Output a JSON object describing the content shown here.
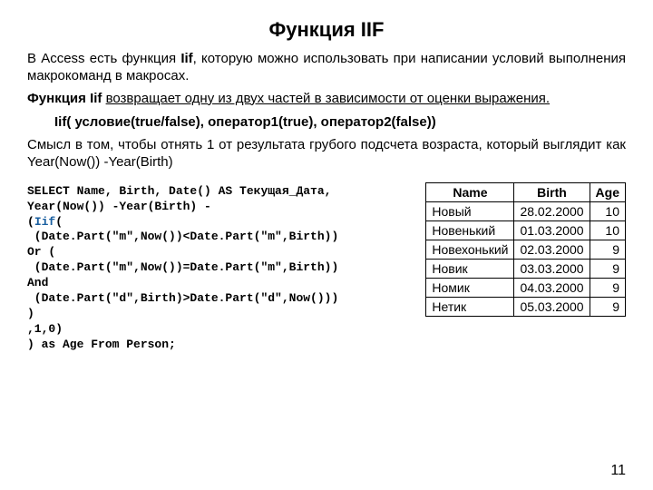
{
  "title": "Функция IIF",
  "para1_a": "В Access есть функция ",
  "para1_iif": "Iif",
  "para1_b": ", которую можно использовать при написании условий выполнения макрокоманд в макросах.",
  "para2_a": "Функция Iif ",
  "para2_b": "возвращает одну из двух частей в зависимости от оценки выражения.",
  "syntax": "Iif( условие(true/false), оператор1(true), оператор2(false))",
  "para3": "Смысл в том, чтобы отнять 1 от результата грубого подсчета возраста, который выглядит как Year(Now()) -Year(Birth)",
  "code": {
    "l1": "SELECT Name, Birth, Date() AS Текущая_Дата,",
    "l2": "Year(Now()) -Year(Birth) -",
    "l3a": "(",
    "l3b": "Iif",
    "l3c": "(",
    "l4": " (Date.Part(\"m\",Now())<Date.Part(\"m\",Birth))",
    "l5": "Or (",
    "l6": " (Date.Part(\"m\",Now())=Date.Part(\"m\",Birth))",
    "l7": "And",
    "l8": " (Date.Part(\"d\",Birth)>Date.Part(\"d\",Now()))",
    "l9": ")",
    "l10": ",1,0)",
    "l11": ") as Age From Person;"
  },
  "table": {
    "headers": [
      "Name",
      "Birth",
      "Age"
    ],
    "rows": [
      [
        "Новый",
        "28.02.2000",
        "10"
      ],
      [
        "Новенький",
        "01.03.2000",
        "10"
      ],
      [
        "Новехонький",
        "02.03.2000",
        "9"
      ],
      [
        "Новик",
        "03.03.2000",
        "9"
      ],
      [
        "Номик",
        "04.03.2000",
        "9"
      ],
      [
        "Нетик",
        "05.03.2000",
        "9"
      ]
    ]
  },
  "pagenum": "11"
}
